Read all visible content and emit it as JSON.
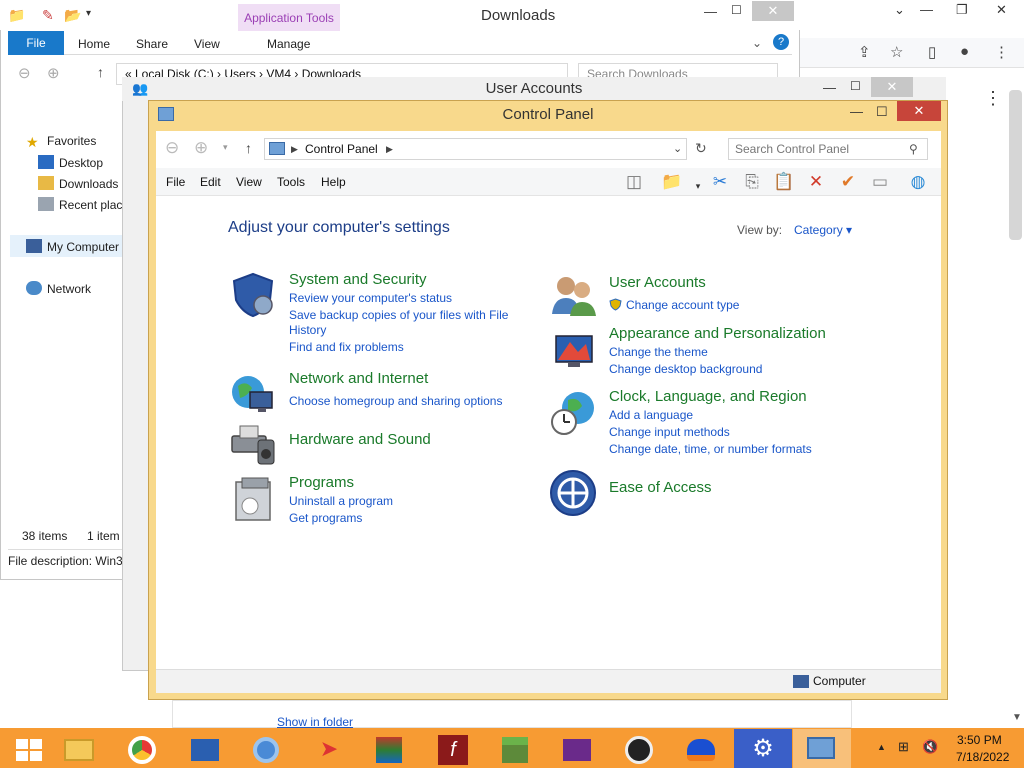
{
  "explorer": {
    "title": "Downloads",
    "app_tools": "Application Tools",
    "tabs": [
      "File",
      "Home",
      "Share",
      "View",
      "Manage"
    ],
    "address": "«  Local Disk (C:)  ›  Users  ›  VM4  ›  Downloads",
    "search_placeholder": "Search Downloads",
    "nav": {
      "favorites": "Favorites",
      "desktop": "Desktop",
      "downloads": "Downloads",
      "recent": "Recent plac",
      "my_computer": "My Computer",
      "network": "Network"
    },
    "status_items": "38 items",
    "status_selected": "1 item",
    "file_description": "File description: Win3"
  },
  "user_accounts": {
    "title": "User Accounts"
  },
  "control_panel": {
    "title": "Control Panel",
    "address": "Control Panel",
    "search_placeholder": "Search Control Panel",
    "menu": [
      "File",
      "Edit",
      "View",
      "Tools",
      "Help"
    ],
    "heading": "Adjust your computer's settings",
    "view_by_label": "View by:",
    "view_by_value": "Category ▾",
    "categories": [
      {
        "title": "System and Security",
        "links": [
          "Review your computer's status",
          "Save backup copies of your files with File",
          "History",
          "Find and fix problems"
        ]
      },
      {
        "title": "Network and Internet",
        "links": [
          "Choose homegroup and sharing options"
        ]
      },
      {
        "title": "Hardware and Sound",
        "links": []
      },
      {
        "title": "Programs",
        "links": [
          "Uninstall a program",
          "Get programs"
        ]
      },
      {
        "title": "User Accounts",
        "links": [
          "Change account type"
        ]
      },
      {
        "title": "Appearance and Personalization",
        "links": [
          "Change the theme",
          "Change desktop background"
        ]
      },
      {
        "title": "Clock, Language, and Region",
        "links": [
          "Add a language",
          "Change input methods",
          "Change date, time, or number formats"
        ]
      },
      {
        "title": "Ease of Access",
        "links": []
      }
    ],
    "status_location": "Computer"
  },
  "behind": {
    "show_in_folder": "Show in folder"
  },
  "taskbar": {
    "time": "3:50 PM",
    "date": "7/18/2022"
  },
  "colors": {
    "taskbar": "#f79b33",
    "cp_frame": "#f8d98c",
    "link": "#1a56c9",
    "category_title": "#1a7a2a",
    "heading": "#1c3d87"
  }
}
